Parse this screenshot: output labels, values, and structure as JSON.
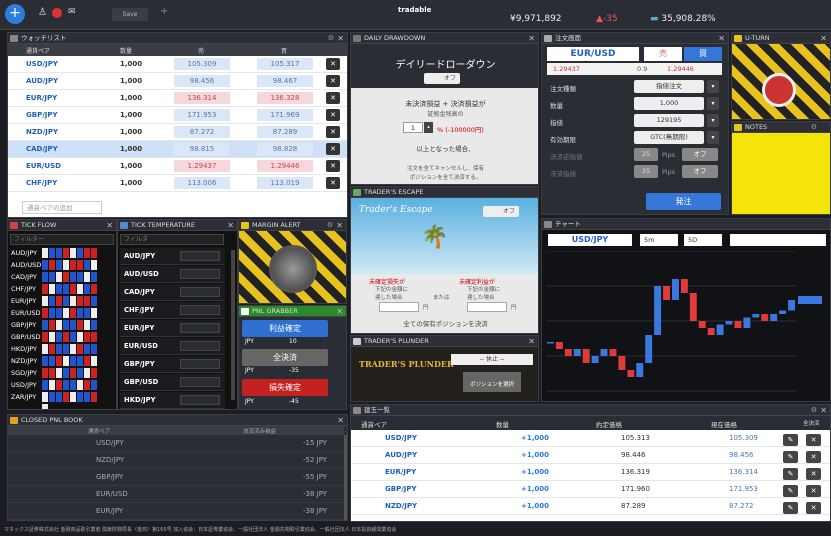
{
  "topbar": {
    "logo": "tradable",
    "balance": "¥9,971,892",
    "pnl_delta": "-35",
    "margin_rate": "35,908.28%",
    "tab": "Save",
    "add_label": "apps"
  },
  "watchlist": {
    "title": "ウォッチリスト",
    "cols": [
      "通貨ペア",
      "数量",
      "売",
      "買"
    ],
    "rows": [
      {
        "sym": "USD/JPY",
        "qty": "1,000",
        "bid": "105.309",
        "ask": "105.317",
        "state": "normal"
      },
      {
        "sym": "AUD/JPY",
        "qty": "1,000",
        "bid": "98.456",
        "ask": "98.467",
        "state": "normal"
      },
      {
        "sym": "EUR/JPY",
        "qty": "1,000",
        "bid": "136.314",
        "ask": "136.328",
        "state": "down"
      },
      {
        "sym": "GBP/JPY",
        "qty": "1,000",
        "bid": "171.953",
        "ask": "171.969",
        "state": "normal"
      },
      {
        "sym": "NZD/JPY",
        "qty": "1,000",
        "bid": "87.272",
        "ask": "87.289",
        "state": "normal"
      },
      {
        "sym": "CAD/JPY",
        "qty": "1,000",
        "bid": "98.815",
        "ask": "98.828",
        "state": "selected"
      },
      {
        "sym": "EUR/USD",
        "qty": "1,000",
        "bid": "1.29437",
        "ask": "1.29446",
        "state": "down"
      },
      {
        "sym": "CHF/JPY",
        "qty": "1,000",
        "bid": "113.006",
        "ask": "113.019",
        "state": "normal"
      }
    ],
    "add_placeholder": "通貨ペアの追加"
  },
  "drawdown": {
    "title": "DAILY DRAWDOWN",
    "heading": "デイリードローダウン",
    "toggle": "オフ",
    "desc1": "未決済損益 + 決済損益が",
    "desc2": "証拠金残高の",
    "pct": "1",
    "pct_suffix": "% (-100000円)",
    "desc3": "以上となった場合、",
    "note1": "注文を全てキャンセルし、保有",
    "note2": "ポジションを全て決済する。"
  },
  "order": {
    "title": "注文画面",
    "pair": "EUR/USD",
    "sell_label": "売",
    "buy_label": "買",
    "sell_price": "1.29437",
    "spread": "0.9",
    "buy_price": "1.29446",
    "fields": [
      {
        "label": "注文種類",
        "value": "指値注文"
      },
      {
        "label": "数量",
        "value": "1,000"
      },
      {
        "label": "指値",
        "value": "129195"
      },
      {
        "label": "有効期限",
        "value": "GTC(無期限)"
      },
      {
        "label": "決済逆指値",
        "value": "25"
      },
      {
        "label": "決済指値",
        "value": "25"
      }
    ],
    "pips": "Pips",
    "off": "オフ",
    "submit": "発注"
  },
  "uturn": {
    "title": "U-TURN"
  },
  "notes": {
    "title": "NOTES"
  },
  "tickflow": {
    "title": "TICK FLOW",
    "filter": "フィルター",
    "pairs": [
      "AUD/JPY",
      "AUD/USD",
      "CAD/JPY",
      "CHF/JPY",
      "EUR/JPY",
      "EUR/USD",
      "GBP/JPY",
      "GBP/USD",
      "HKD/JPY",
      "NZD/JPY",
      "SGD/JPY",
      "USD/JPY",
      "ZAR/JPY"
    ]
  },
  "ticktemp": {
    "title": "TICK TEMPERATURE",
    "filter": "フィルタ",
    "pairs": [
      "AUD/JPY",
      "AUD/USD",
      "CAD/JPY",
      "CHF/JPY",
      "EUR/JPY",
      "EUR/USD",
      "GBP/JPY",
      "GBP/USD",
      "HKD/JPY",
      "NZD/JPY"
    ]
  },
  "margin": {
    "title": "MARGIN ALERT"
  },
  "pnlgrab": {
    "title": "PNL GRABBER",
    "profit": "利益確定",
    "profit_ccy": "JPY",
    "profit_val": "10",
    "all": "全決済",
    "all_ccy": "JPY",
    "all_val": "-35",
    "loss": "損失確定",
    "loss_ccy": "JPY",
    "loss_val": "-45"
  },
  "escape": {
    "title": "TRADER'S ESCAPE",
    "logo": "Trader's Escape",
    "toggle": "オフ",
    "l1": "未確定損失が",
    "l2": "下記の金額に",
    "l3": "達した場合",
    "or": "または",
    "r1": "未確定利益が",
    "r2": "下記の金額に",
    "r3": "達した場合",
    "unit": "円",
    "bottom": "全ての保有ポジションを決済"
  },
  "plunder": {
    "title": "TRADER'S PLUNDER",
    "logo": "TRADER'S PLUNDER",
    "select": "-- 休止 --",
    "btn": "ポジションを選択"
  },
  "chart": {
    "title": "チャート",
    "pair": "USD/JPY",
    "tf": "5m",
    "range": "5D"
  },
  "chart_data": {
    "type": "candlestick",
    "title": "USD/JPY",
    "series": [
      {
        "name": "USD/JPY",
        "values": [
          104.7,
          104.6,
          104.5,
          104.6,
          104.4,
          104.5,
          104.6,
          104.5,
          104.3,
          104.2,
          104.4,
          104.8,
          105.5,
          105.3,
          105.6,
          105.4,
          105.0,
          104.9,
          104.8,
          104.95,
          105.0,
          104.9,
          105.05,
          105.1,
          105.0,
          105.1,
          105.15,
          105.3
        ]
      }
    ],
    "ylim": [
      104.0,
      106.0
    ]
  },
  "positions": {
    "title": "建玉一覧",
    "cols": [
      "通貨ペア",
      "数量",
      "約定価格",
      "現在価格",
      "全決済"
    ],
    "rows": [
      {
        "sym": "USD/JPY",
        "qty": "+1,000",
        "open": "105.313",
        "cur": "105.309"
      },
      {
        "sym": "AUD/JPY",
        "qty": "+1,000",
        "open": "98.446",
        "cur": "98.456"
      },
      {
        "sym": "EUR/JPY",
        "qty": "+1,000",
        "open": "136.319",
        "cur": "136.314"
      },
      {
        "sym": "GBP/JPY",
        "qty": "+1,000",
        "open": "171.960",
        "cur": "171.953"
      },
      {
        "sym": "NZD/JPY",
        "qty": "+1,000",
        "open": "87.289",
        "cur": "87.272"
      }
    ]
  },
  "closed": {
    "title": "CLOSED PNL BOOK",
    "cols": [
      "通貨ペア",
      "決済済み損益"
    ],
    "rows": [
      {
        "sym": "USD/JPY",
        "pnl": "-15 JPY"
      },
      {
        "sym": "NZD/JPY",
        "pnl": "-52 JPY"
      },
      {
        "sym": "GBP/JPY",
        "pnl": "-55 JPY"
      },
      {
        "sym": "EUR/USD",
        "pnl": "-38 JPY"
      },
      {
        "sym": "EUR/JPY",
        "pnl": "-38 JPY"
      }
    ]
  },
  "footer": "マネックス証券株式会社 金融商品取引業者 関東財務局長（金商）第165号 加入協会：日本証券業協会、一般社団法人 金融先物取引業協会、一般社団法人 日本投資顧問業協会"
}
